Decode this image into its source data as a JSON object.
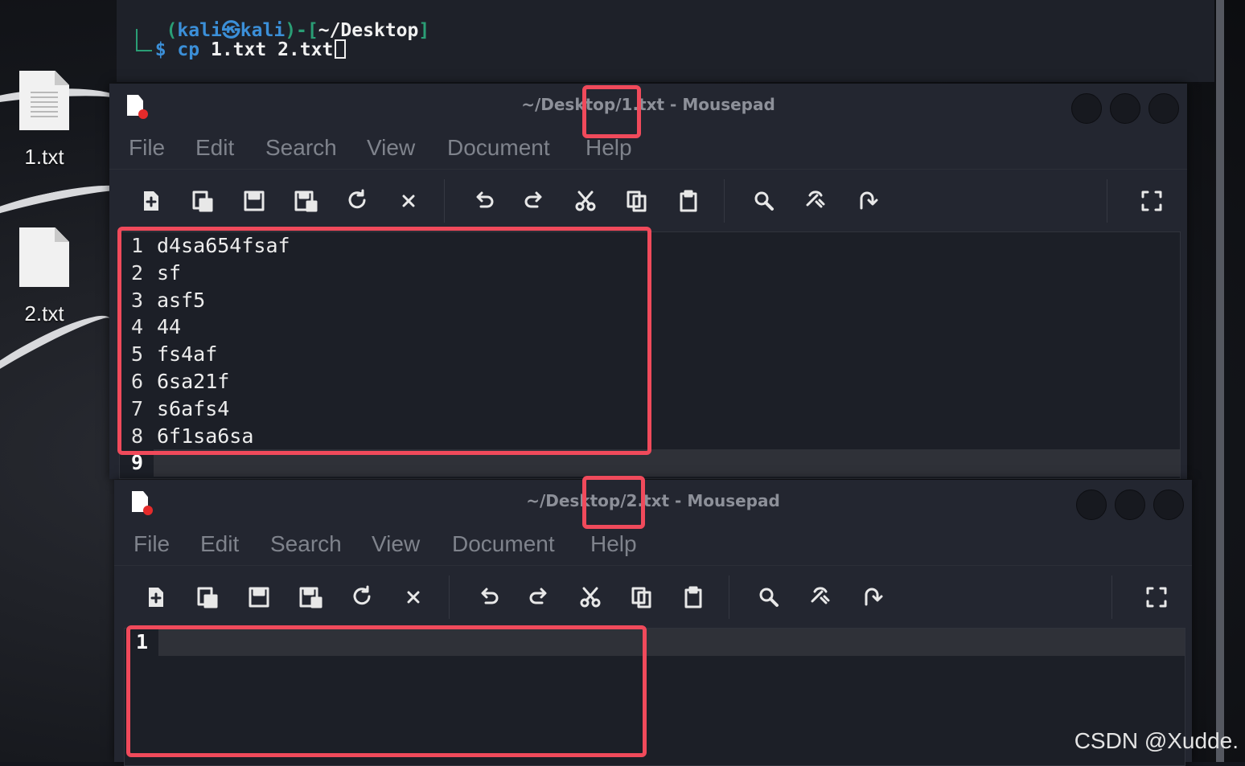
{
  "desktop": {
    "icons": [
      {
        "label": "1.txt",
        "icon": "text-file-icon"
      },
      {
        "label": "2.txt",
        "icon": "blank-file-icon"
      }
    ]
  },
  "terminal": {
    "prompt_open": "┌──(",
    "user": "kali",
    "at_symbol": "㉿",
    "host": "kali",
    "prompt_mid": ")-[",
    "path": "~/Desktop",
    "prompt_close": "]",
    "prompt_line2": "└─",
    "dollar": "$",
    "command": "cp",
    "args": "1.txt 2.txt"
  },
  "window1": {
    "title_prefix": "~/Desktop/",
    "title_file": "1.txt",
    "title_suffix": " - Mousepad",
    "lines": [
      {
        "num": "1",
        "text": "d4sa654fsaf"
      },
      {
        "num": "2",
        "text": "sf"
      },
      {
        "num": "3",
        "text": "asf5"
      },
      {
        "num": "4",
        "text": "44"
      },
      {
        "num": "5",
        "text": "fs4af"
      },
      {
        "num": "6",
        "text": "6sa21f"
      },
      {
        "num": "7",
        "text": "s6afs4"
      },
      {
        "num": "8",
        "text": "6f1sa6sa"
      },
      {
        "num": "9",
        "text": ""
      }
    ]
  },
  "window2": {
    "title_prefix": "~/Desktop/",
    "title_file": "2.txt",
    "title_suffix": " - Mousepad",
    "lines": [
      {
        "num": "1",
        "text": ""
      }
    ]
  },
  "menu": [
    "File",
    "Edit",
    "Search",
    "View",
    "Document",
    "Help"
  ],
  "toolbar_icons": [
    "new-document-icon",
    "new-window-icon",
    "save-icon",
    "save-as-icon",
    "reload-icon",
    "close-icon",
    "undo-icon",
    "redo-icon",
    "cut-icon",
    "copy-icon",
    "paste-icon",
    "find-icon",
    "find-replace-icon",
    "go-to-line-icon",
    "fullscreen-icon"
  ],
  "highlight_color": "#f04a5b",
  "watermark": "CSDN @Xudde."
}
